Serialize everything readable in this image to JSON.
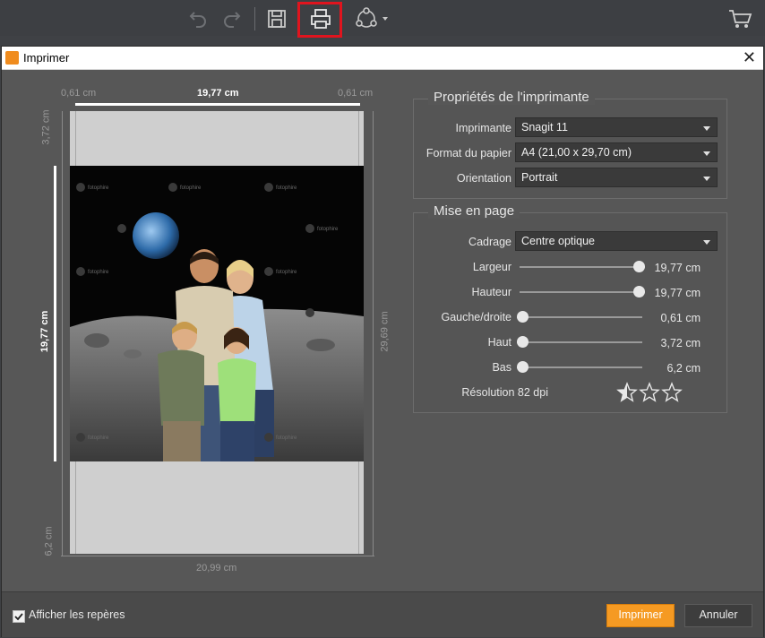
{
  "toolbar": {
    "icons": [
      "undo-icon",
      "redo-icon",
      "save-icon",
      "print-icon",
      "share-icon",
      "cart-icon"
    ]
  },
  "dialog": {
    "title": "Imprimer"
  },
  "preview": {
    "margin_left_label": "0,61 cm",
    "width_label": "19,77 cm",
    "margin_right_label": "0,61 cm",
    "top_margin_label": "3,72 cm",
    "height_label": "19,77 cm",
    "page_height_label": "29,69 cm",
    "bottom_margin_label": "6,2 cm",
    "page_width_label": "20,99 cm",
    "watermark": "fotophire"
  },
  "printer_props": {
    "title": "Propriétés de l'imprimante",
    "printer_label": "Imprimante",
    "printer_value": "Snagit 11",
    "paper_label": "Format du papier",
    "paper_value": "A4 (21,00 x 29,70 cm)",
    "orientation_label": "Orientation",
    "orientation_value": "Portrait"
  },
  "layout": {
    "title": "Mise en page",
    "crop_label": "Cadrage",
    "crop_value": "Centre optique",
    "sliders": [
      {
        "label": "Largeur",
        "value": "19,77 cm",
        "level": 1.0
      },
      {
        "label": "Hauteur",
        "value": "19,77 cm",
        "level": 1.0
      },
      {
        "label": "Gauche/droite",
        "value": "0,61 cm",
        "level": 0.0
      },
      {
        "label": "Haut",
        "value": "3,72 cm",
        "level": 0.0
      },
      {
        "label": "Bas",
        "value": "6,2 cm",
        "level": 0.0
      }
    ],
    "resolution": "Résolution 82 dpi",
    "rating": 0.5
  },
  "footer": {
    "show_guides_label": "Afficher les repères",
    "show_guides_checked": true,
    "print_label": "Imprimer",
    "cancel_label": "Annuler"
  },
  "colors": {
    "accent": "#f59a23",
    "highlight": "#e0141e"
  }
}
